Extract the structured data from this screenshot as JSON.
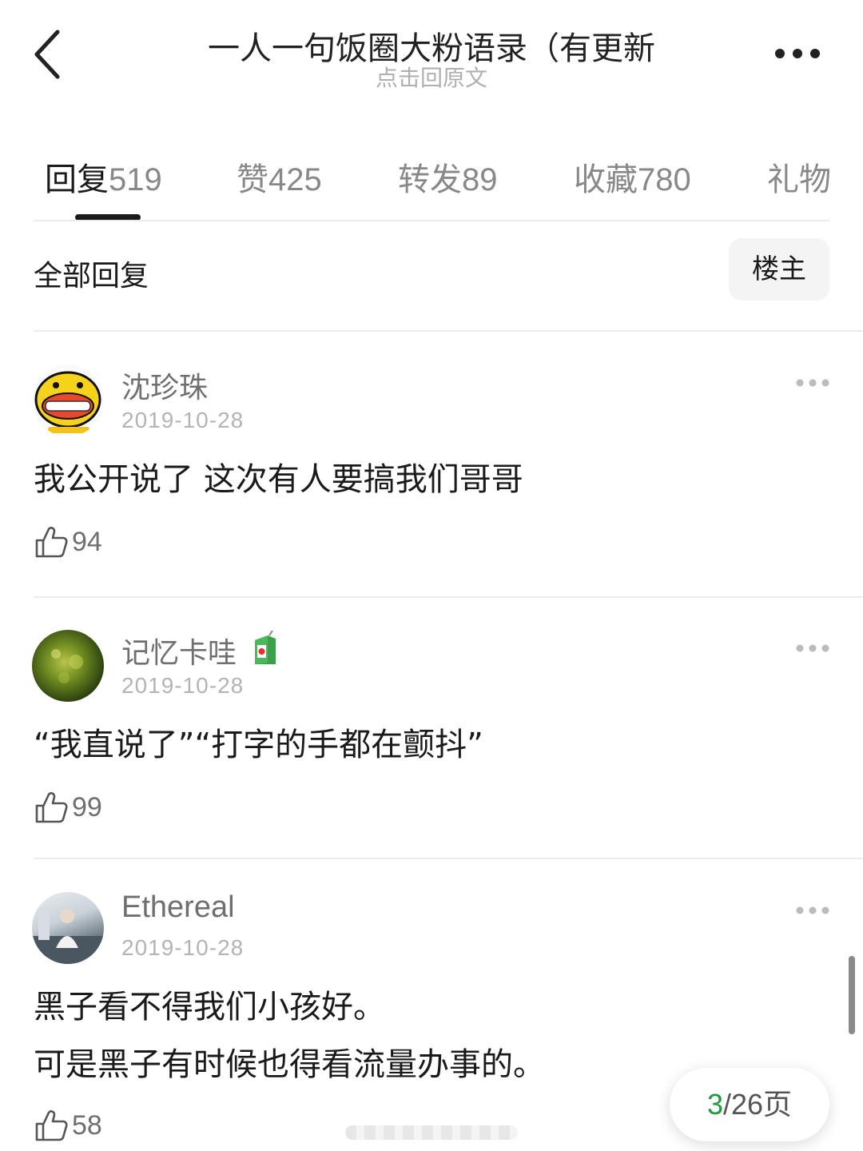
{
  "header": {
    "title": "一人一句饭圈大粉语录（有更新",
    "subtitle": "点击回原文"
  },
  "tabs": [
    {
      "label": "回复",
      "count": "519",
      "active": true
    },
    {
      "label": "赞",
      "count": "425"
    },
    {
      "label": "转发",
      "count": "89"
    },
    {
      "label": "收藏",
      "count": "780"
    },
    {
      "label": "礼物",
      "count": ""
    }
  ],
  "filter": {
    "label": "全部回复",
    "button": "楼主"
  },
  "comments": [
    {
      "name": "沈珍珠",
      "date": "2019-10-28",
      "lines": [
        "我公开说了 这次有人要搞我们哥哥"
      ],
      "likes": "94",
      "avatar_icon": "yellow-smiley-avatar"
    },
    {
      "name": "记忆卡哇",
      "date": "2019-10-28",
      "lines": [
        "“我直说了”“打字的手都在颤抖”"
      ],
      "likes": "99",
      "badge_icon": "juice-box-icon",
      "avatar_icon": "green-nature-avatar"
    },
    {
      "name": "Ethereal",
      "date": "2019-10-28",
      "lines": [
        "黑子看不得我们小孩好。",
        "可是黑子有时候也得看流量办事的。"
      ],
      "likes": "58",
      "avatar_icon": "person-photo-avatar"
    }
  ],
  "pager": {
    "current": "3",
    "total": "/26",
    "suffix": "页"
  },
  "colors": {
    "accent_green": "#1f9a3c",
    "text_primary": "#1a1a1a",
    "text_secondary": "#6f6f6f",
    "text_muted": "#b4b4b4"
  }
}
